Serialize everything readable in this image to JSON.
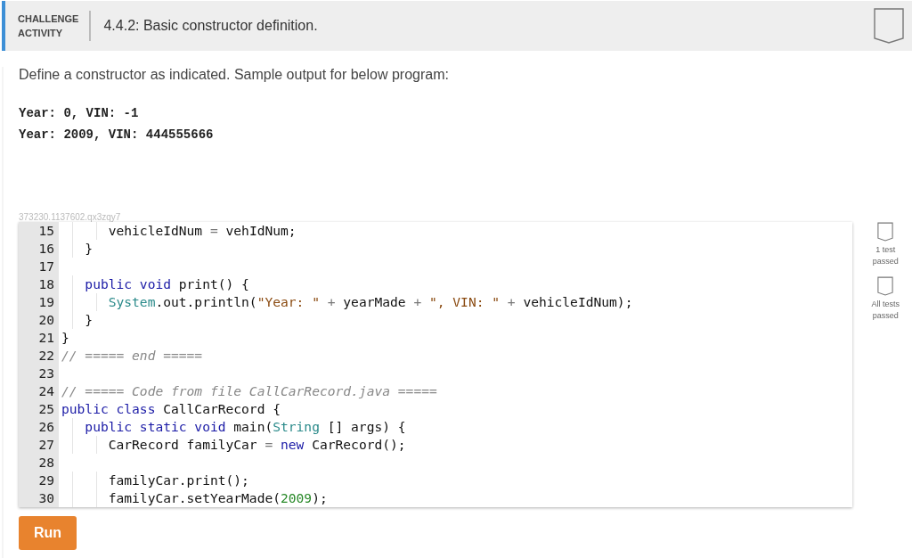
{
  "header": {
    "label_lines": [
      "CHALLENGE",
      "ACTIVITY"
    ],
    "title": "4.4.2: Basic constructor definition."
  },
  "instructions": "Define a constructor as indicated. Sample output for below program:",
  "sample_output": [
    "Year: 0, VIN: -1",
    "Year: 2009, VIN: 444555666"
  ],
  "activity_id": "373230.1137602.qx3zqy7",
  "code_lines": [
    {
      "number": "15",
      "kind": "statement",
      "tokens": [
        {
          "kind": "plain",
          "text": "vehicleIdNum "
        },
        {
          "kind": "op",
          "text": "="
        },
        {
          "kind": "plain",
          "text": " vehIdNum;"
        }
      ]
    },
    {
      "number": "16",
      "kind": "member",
      "tokens": [
        {
          "kind": "plain",
          "text": "}"
        }
      ]
    },
    {
      "number": "17",
      "kind": "blank"
    },
    {
      "number": "18",
      "kind": "member",
      "tokens": [
        {
          "kind": "keyword",
          "text": "public void"
        },
        {
          "kind": "plain",
          "text": " print() {"
        }
      ]
    },
    {
      "number": "19",
      "kind": "statement",
      "tokens": [
        {
          "kind": "type",
          "text": "System"
        },
        {
          "kind": "plain",
          "text": ".out.println("
        },
        {
          "kind": "string",
          "text": "\"Year: \""
        },
        {
          "kind": "op",
          "text": " + "
        },
        {
          "kind": "plain",
          "text": "yearMade"
        },
        {
          "kind": "op",
          "text": " + "
        },
        {
          "kind": "string",
          "text": "\", VIN: \""
        },
        {
          "kind": "op",
          "text": " + "
        },
        {
          "kind": "plain",
          "text": "vehicleIdNum);"
        }
      ]
    },
    {
      "number": "20",
      "kind": "member",
      "tokens": [
        {
          "kind": "plain",
          "text": "}"
        }
      ]
    },
    {
      "number": "21",
      "kind": "top",
      "tokens": [
        {
          "kind": "plain",
          "text": "}"
        }
      ]
    },
    {
      "number": "22",
      "kind": "top",
      "tokens": [
        {
          "kind": "comment",
          "text": "// ===== end ====="
        }
      ]
    },
    {
      "number": "23",
      "kind": "blank"
    },
    {
      "number": "24",
      "kind": "top",
      "tokens": [
        {
          "kind": "comment",
          "text": "// ===== Code from file CallCarRecord.java ====="
        }
      ]
    },
    {
      "number": "25",
      "kind": "top",
      "tokens": [
        {
          "kind": "keyword",
          "text": "public class"
        },
        {
          "kind": "plain",
          "text": " CallCarRecord {"
        }
      ]
    },
    {
      "number": "26",
      "kind": "member",
      "tokens": [
        {
          "kind": "keyword",
          "text": "public static void"
        },
        {
          "kind": "plain",
          "text": " main("
        },
        {
          "kind": "type",
          "text": "String"
        },
        {
          "kind": "plain",
          "text": " [] args) {"
        }
      ]
    },
    {
      "number": "27",
      "kind": "statement",
      "tokens": [
        {
          "kind": "plain",
          "text": "CarRecord familyCar "
        },
        {
          "kind": "op",
          "text": "= "
        },
        {
          "kind": "keyword",
          "text": "new"
        },
        {
          "kind": "plain",
          "text": " CarRecord();"
        }
      ]
    },
    {
      "number": "28",
      "kind": "blank"
    },
    {
      "number": "29",
      "kind": "statement",
      "tokens": [
        {
          "kind": "plain",
          "text": "familyCar.print();"
        }
      ]
    },
    {
      "number": "30",
      "kind": "statement",
      "tokens": [
        {
          "kind": "plain",
          "text": "familyCar.setYearMade("
        },
        {
          "kind": "number",
          "text": "2009"
        },
        {
          "kind": "plain",
          "text": ");"
        }
      ]
    }
  ],
  "progress": [
    {
      "label": "1 test passed",
      "passed": false
    },
    {
      "label": "All tests passed",
      "passed": false
    }
  ],
  "run_button": "Run"
}
